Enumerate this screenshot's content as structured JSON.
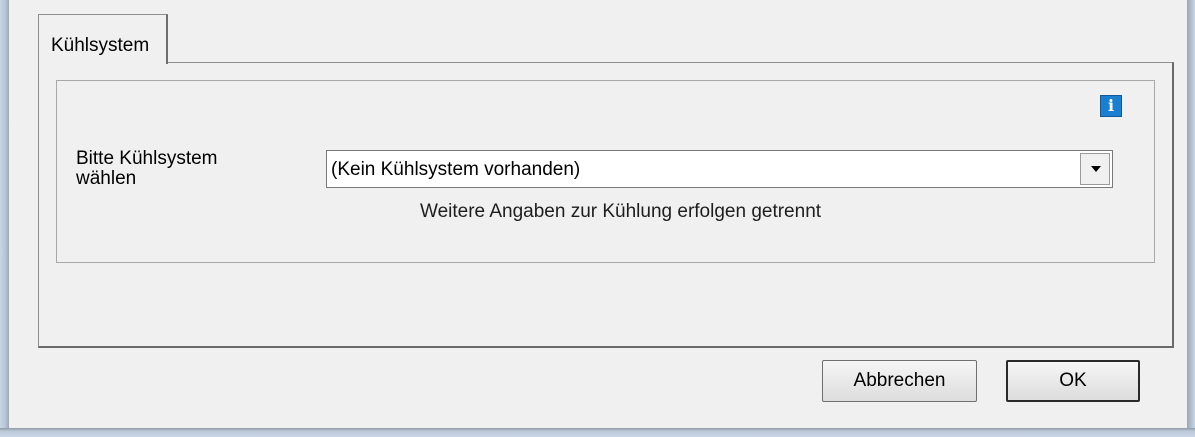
{
  "dialog": {
    "tab_label": "Kühlsystem",
    "field_label": "Bitte Kühlsystem\nwählen",
    "select_value": "(Kein Kühlsystem vorhanden)",
    "hint_text": "Weitere Angaben zur Kühlung erfolgen getrennt",
    "info_icon_glyph": "i",
    "cancel_label": "Abbrechen",
    "ok_label": "OK"
  },
  "icons": {
    "info": "info-icon",
    "dropdown": "chevron-down-icon"
  },
  "colors": {
    "window_background": "#f0f0f0",
    "info_icon": "#1a7fd0",
    "frame": "#b7c6d7"
  }
}
